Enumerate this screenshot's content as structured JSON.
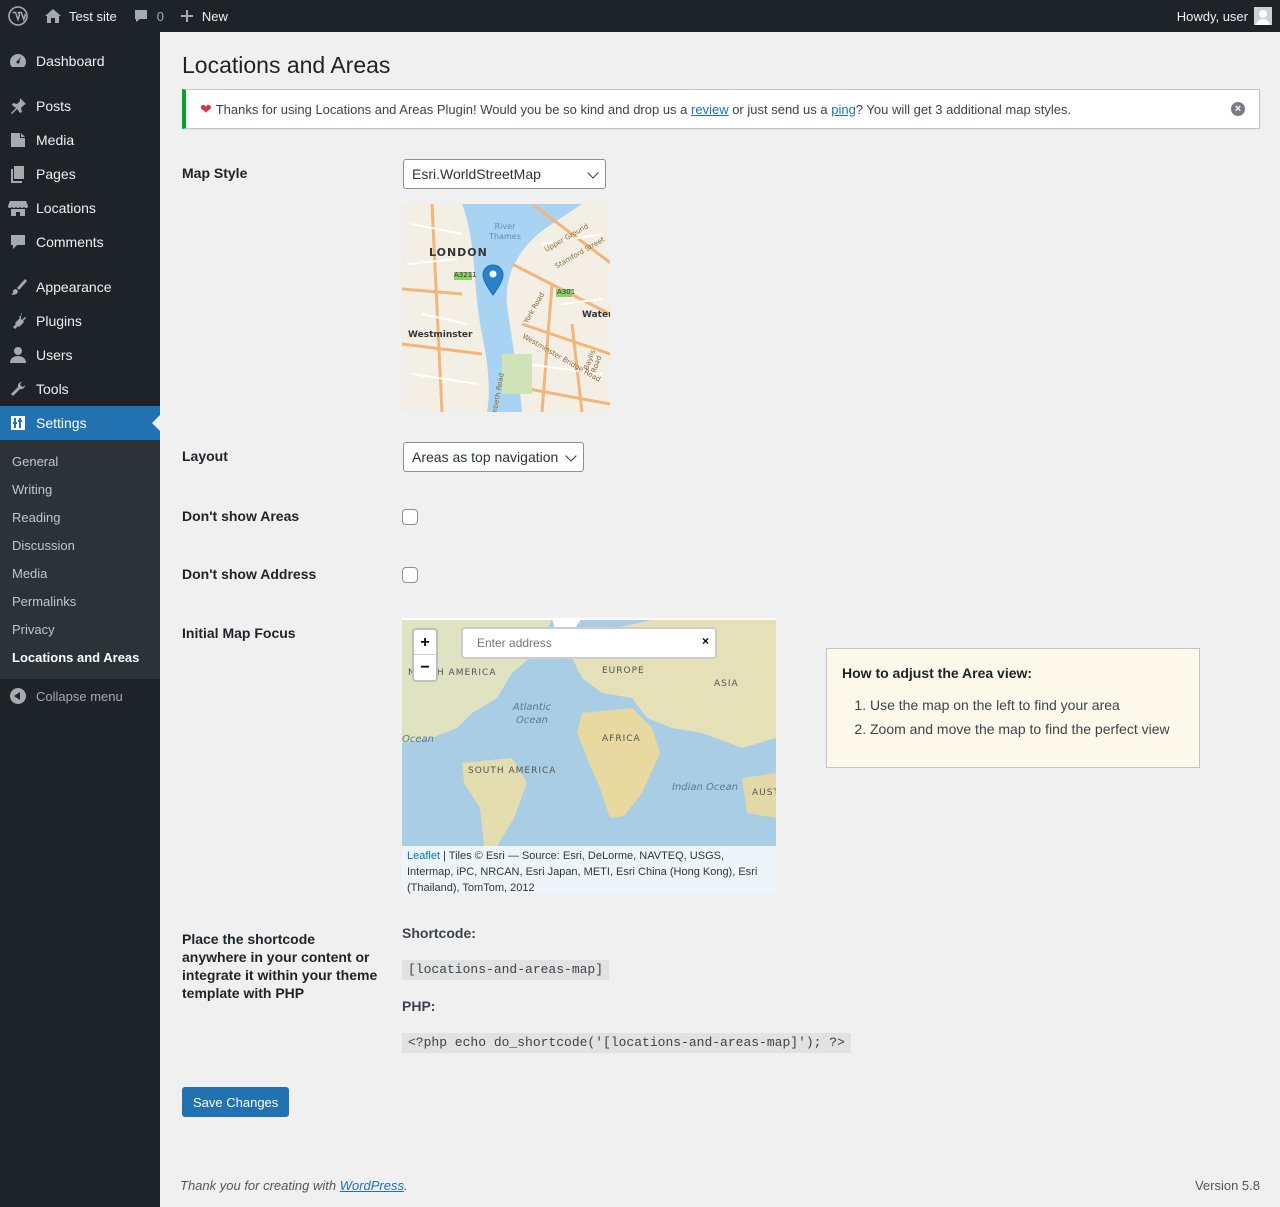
{
  "admin_bar": {
    "site_name": "Test site",
    "comments_count": "0",
    "new_label": "New",
    "howdy": "Howdy, user"
  },
  "sidebar": {
    "items": [
      {
        "label": "Dashboard",
        "icon": "dashboard-icon"
      },
      {
        "label": "Posts",
        "icon": "pin-icon"
      },
      {
        "label": "Media",
        "icon": "media-icon"
      },
      {
        "label": "Pages",
        "icon": "pages-icon"
      },
      {
        "label": "Locations",
        "icon": "store-icon"
      },
      {
        "label": "Comments",
        "icon": "comment-icon"
      },
      {
        "label": "Appearance",
        "icon": "brush-icon"
      },
      {
        "label": "Plugins",
        "icon": "plug-icon"
      },
      {
        "label": "Users",
        "icon": "users-icon"
      },
      {
        "label": "Tools",
        "icon": "wrench-icon"
      },
      {
        "label": "Settings",
        "icon": "settings-icon"
      }
    ],
    "submenu": [
      "General",
      "Writing",
      "Reading",
      "Discussion",
      "Media",
      "Permalinks",
      "Privacy",
      "Locations and Areas"
    ],
    "collapse": "Collapse menu"
  },
  "page": {
    "title": "Locations and Areas",
    "notice": {
      "before": "Thanks for using Locations and Areas Plugin! Would you be so kind and drop us a ",
      "review_link": "review",
      "middle": " or just send us a ",
      "ping_link": "ping",
      "after": "? You will get 3 additional map styles."
    },
    "map_style": {
      "label": "Map Style",
      "value": "Esri.WorldStreetMap"
    },
    "preview_map": {
      "labels": [
        "LONDON",
        "River Thames",
        "Westminster",
        "Waterl",
        "A3211",
        "A301",
        "Stamford Street",
        "Upper Ground",
        "York Road",
        "Lambeth Road",
        "Westminster Bridge Road",
        "Baylis Road"
      ]
    },
    "layout": {
      "label": "Layout",
      "value": "Areas as top navigation"
    },
    "dont_show_areas": {
      "label": "Don't show Areas",
      "checked": false
    },
    "dont_show_address": {
      "label": "Don't show Address",
      "checked": false
    },
    "initial_focus": {
      "label": "Initial Map Focus",
      "search_placeholder": "Enter address",
      "map_labels": [
        "NORTH AMERICA",
        "EUROPE",
        "ASIA",
        "Atlantic Ocean",
        "AFRICA",
        "SOUTH AMERICA",
        "Indian Ocean",
        "Ocean",
        "AUST"
      ],
      "attribution_link": "Leaflet",
      "attribution_text": " | Tiles © Esri — Source: Esri, DeLorme, NAVTEQ, USGS, Intermap, iPC, NRCAN, Esri Japan, METI, Esri China (Hong Kong), Esri (Thailand), TomTom, 2012"
    },
    "howto": {
      "title": "How to adjust the Area view:",
      "steps": [
        "Use the map on the left to find your area",
        "Zoom and move the map to find the perfect view"
      ]
    },
    "shortcode": {
      "label": "Place the shortcode anywhere in your content or integrate it within your theme template with PHP",
      "shortcode_heading": "Shortcode:",
      "shortcode_value": "[locations-and-areas-map]",
      "php_heading": "PHP:",
      "php_value": "<?php echo do_shortcode('[locations-and-areas-map]'); ?>"
    },
    "save_label": "Save Changes"
  },
  "footer": {
    "thanks_before": "Thank you for creating with ",
    "thanks_link": "WordPress",
    "thanks_after": ".",
    "version": "Version 5.8"
  },
  "colors": {
    "accent": "#2271b1",
    "notice_border": "#00a32a",
    "sidebar": "#1d2327"
  }
}
